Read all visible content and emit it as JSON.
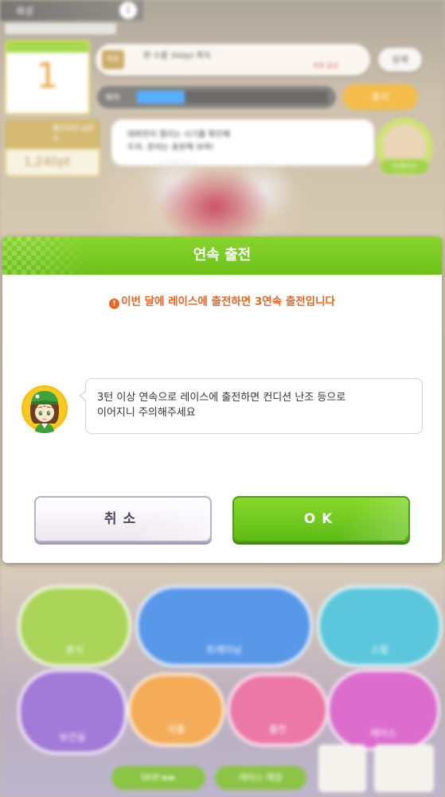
{
  "background": {
    "top_label": "육성",
    "goal_badge": "목표",
    "goal_text": "팬 수를 300pt 획득",
    "goal_sub": "목표 달성",
    "goal_button": "상세",
    "energy_label": "체력",
    "energy_level": 0.25,
    "rest_button": "휴식",
    "fans_label": "출주까지 남은 수",
    "fans_value": "1,240pt",
    "speech_line1": "데뷔전이 열리는 시기를 확인해",
    "speech_line2": "두자. 준비는 충분해 보여!",
    "avatar_tag": "트레이너",
    "menu": [
      "휴식",
      "트레이닝",
      "스킬",
      "보건실",
      "외출",
      "출전",
      "레이스"
    ],
    "skip_label": "SKIP ►►",
    "race_label": "레이스 예정"
  },
  "dialog": {
    "title": "연속 출전",
    "warning_icon": "!",
    "warning": "이번 달에 레이스에 출전하면 3연속 출전입니다",
    "speech_line1": "3턴 이상 연속으로 레이스에 출전하면 컨디션 난조 등으로",
    "speech_line2": "이어지니 주의해주세요",
    "cancel_label": "취소",
    "ok_label": "OK"
  },
  "colors": {
    "accent_green": "#6cc21a",
    "warning_orange": "#f06420",
    "cancel_border": "#b8b1c8"
  },
  "icons": [
    "warning-icon",
    "character-avatar-icon",
    "info-icon"
  ]
}
